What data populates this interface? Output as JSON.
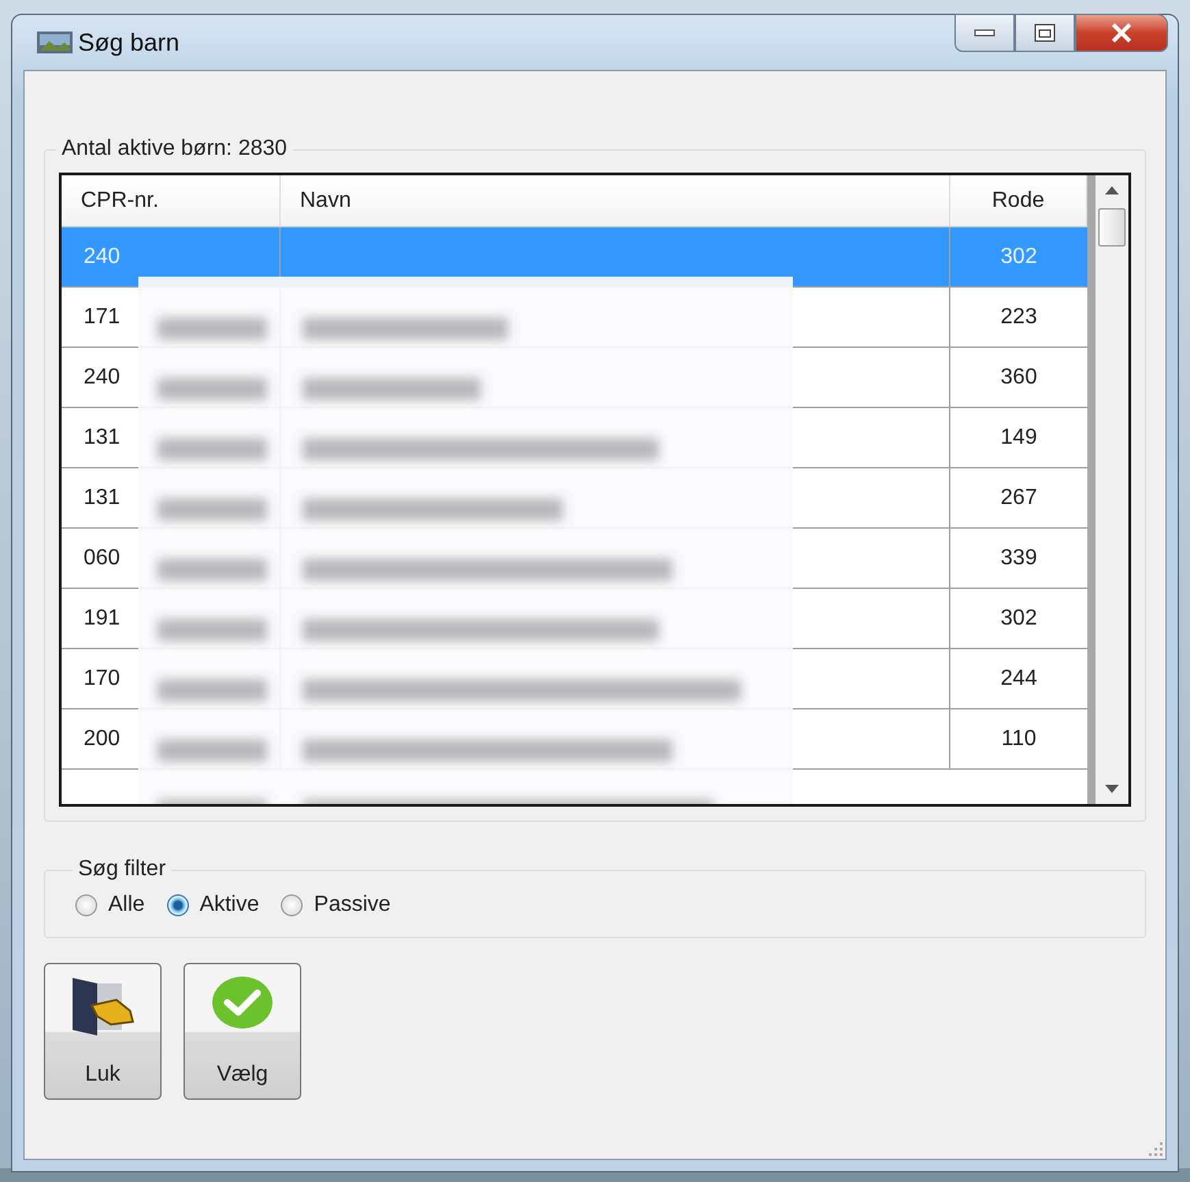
{
  "window": {
    "title": "Søg barn"
  },
  "list_group": {
    "title": "Antal aktive børn: 2830"
  },
  "table": {
    "columns": [
      "CPR-nr.",
      "Navn",
      "Rode"
    ],
    "rows": [
      {
        "cpr": "240",
        "rode": "302",
        "selected": true
      },
      {
        "cpr": "171",
        "rode": "223",
        "selected": false
      },
      {
        "cpr": "240",
        "rode": "360",
        "selected": false
      },
      {
        "cpr": "131",
        "rode": "149",
        "selected": false
      },
      {
        "cpr": "131",
        "rode": "267",
        "selected": false
      },
      {
        "cpr": "060",
        "rode": "339",
        "selected": false
      },
      {
        "cpr": "191",
        "rode": "302",
        "selected": false
      },
      {
        "cpr": "170",
        "rode": "244",
        "selected": false
      },
      {
        "cpr": "200",
        "rode": "110",
        "selected": false
      }
    ]
  },
  "filter": {
    "title": "Søg filter",
    "options": [
      {
        "label": "Alle",
        "selected": false
      },
      {
        "label": "Aktive",
        "selected": true
      },
      {
        "label": "Passive",
        "selected": false
      }
    ]
  },
  "buttons": [
    {
      "label": "Luk",
      "kind": "exit"
    },
    {
      "label": "Vælg",
      "kind": "confirm"
    }
  ]
}
